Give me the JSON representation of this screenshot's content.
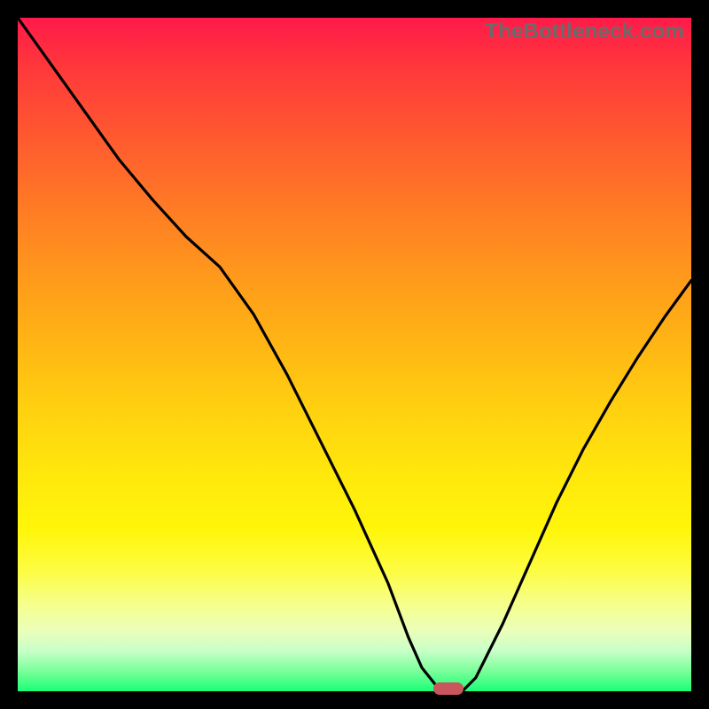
{
  "watermark": "TheBottleneck.com",
  "colors": {
    "frame": "#000000",
    "curve": "#000000",
    "marker": "#c9565c"
  },
  "chart_data": {
    "type": "line",
    "title": "",
    "xlabel": "",
    "ylabel": "",
    "xlim": [
      0,
      100
    ],
    "ylim": [
      0,
      100
    ],
    "grid": false,
    "legend": false,
    "series": [
      {
        "name": "curve",
        "x": [
          0,
          5,
          10,
          15,
          20,
          25,
          30,
          35,
          40,
          45,
          50,
          55,
          58,
          60,
          62,
          64,
          66,
          68,
          72,
          76,
          80,
          84,
          88,
          92,
          96,
          100
        ],
        "y": [
          100,
          93,
          86,
          79,
          73,
          67.5,
          63,
          56,
          47,
          37,
          27,
          16,
          8,
          3.5,
          1,
          0,
          0,
          2,
          10,
          19,
          28,
          36,
          43,
          49.5,
          55.5,
          61
        ]
      }
    ],
    "min_marker": {
      "x": 64,
      "y": 0
    }
  }
}
